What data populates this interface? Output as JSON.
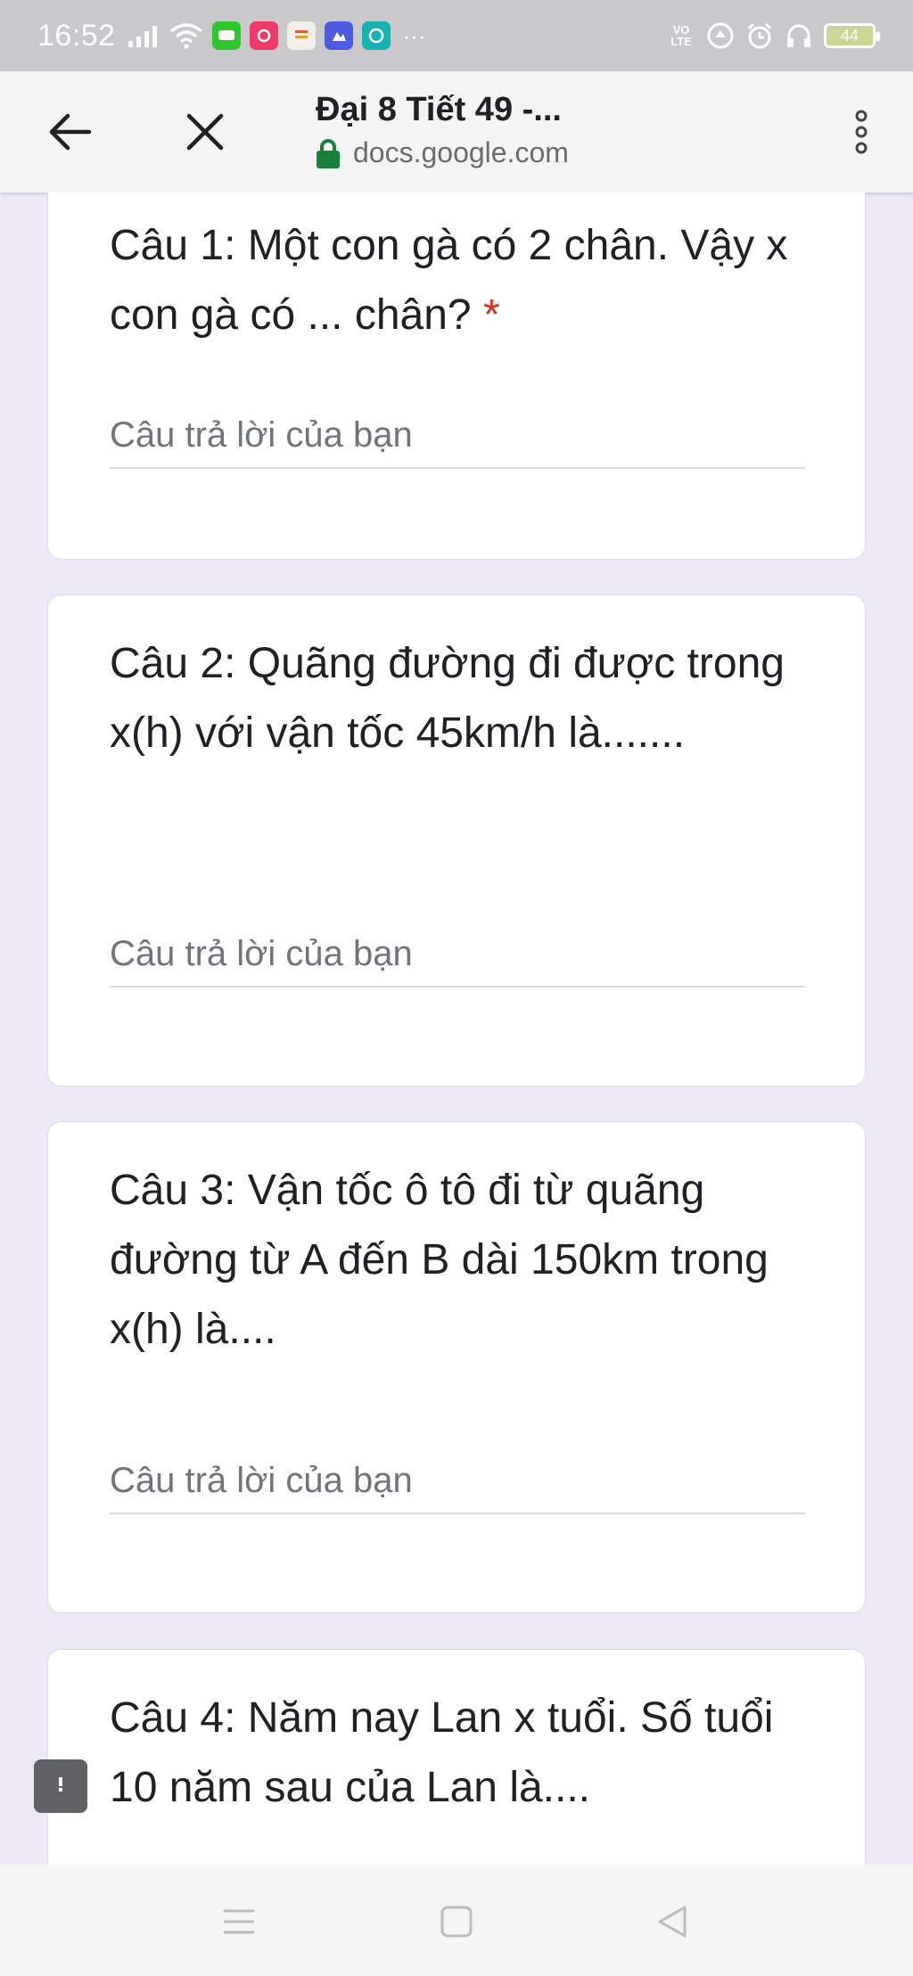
{
  "status_bar": {
    "time": "16:52",
    "battery_level": "44",
    "volte": "VO\nLTE",
    "more_indicator": "···",
    "notif_icons": [
      "message-app-icon",
      "camera-app-icon",
      "news-app-icon",
      "gallery-app-icon",
      "browser-app-icon"
    ]
  },
  "toolbar": {
    "title": "Đại 8 Tiết 49 -...",
    "url": "docs.google.com"
  },
  "questions": [
    {
      "text": "Câu 1: Một con gà có 2 chân. Vậy x con gà có ... chân?",
      "required_mark": "*",
      "placeholder": "Câu trả lời của bạn"
    },
    {
      "text": "Câu 2: Quãng đường đi được trong x(h) với vận tốc 45km/h là.......",
      "placeholder": "Câu trả lời của bạn"
    },
    {
      "text": "Câu 3: Vận tốc ô tô đi từ quãng đường từ A đến B dài 150km trong x(h) là....",
      "placeholder": "Câu trả lời của bạn"
    },
    {
      "text": "Câu 4: Năm nay Lan x tuổi. Số tuổi 10 năm sau của Lan là...."
    }
  ],
  "colors": {
    "page_bg": "#ede8f6",
    "required": "#d93025",
    "lock": "#188038"
  }
}
